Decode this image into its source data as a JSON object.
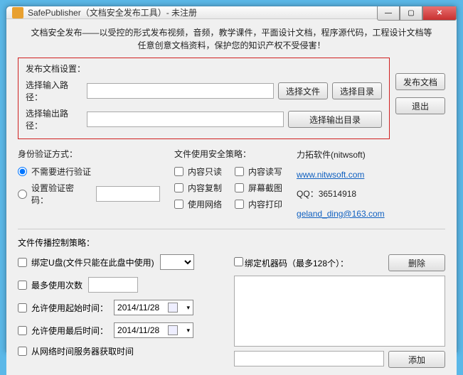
{
  "title": "SafePublisher（文档安全发布工具）- 未注册",
  "intro1": "文档安全发布——以受控的形式发布视频，音频，教学课件，平面设计文档，程序源代码，工程设计文档等",
  "intro2": "任意创意文档资料，保护您的知识产权不受侵害！",
  "pub": {
    "hdr": "发布文档设置：",
    "inLabel": "选择输入路径：",
    "outLabel": "选择输出路径：",
    "selFile": "选择文件",
    "selDir": "选择目录",
    "selOut": "选择输出目录"
  },
  "side": {
    "publish": "发布文档",
    "exit": "退出"
  },
  "auth": {
    "hdr": "身份验证方式：",
    "none": "不需要进行验证",
    "pwd": "设置验证密码："
  },
  "policy": {
    "hdr": "文件使用安全策略：",
    "ro": "内容只读",
    "rw": "内容读写",
    "copy": "内容复制",
    "shot": "屏幕截图",
    "net": "使用网络",
    "print": "内容打印"
  },
  "info": {
    "company": "力拓软件(nitwsoft)",
    "url": "www.nitwsoft.com",
    "qq": "QQ：36514918",
    "email": "geland_ding@163.com"
  },
  "prop": {
    "hdr": "文件传播控制策略：",
    "usb": "绑定U盘(文件只能在此盘中使用)",
    "maxUse": "最多使用次数",
    "start": "允许使用起始时间：",
    "end": "允许使用最后时间：",
    "netTime": "从网络时间服务器获取时间",
    "date": "2014/11/28"
  },
  "machine": {
    "bind": "绑定机器码（最多128个）：",
    "del": "删除",
    "add": "添加"
  }
}
